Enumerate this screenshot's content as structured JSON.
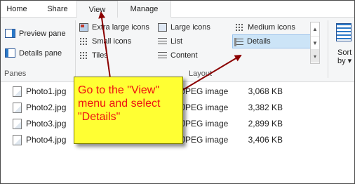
{
  "tabs": [
    "Home",
    "Share",
    "View",
    "Manage"
  ],
  "panes": {
    "preview_label": "Preview pane",
    "details_label": "Details pane",
    "group_label": "Panes"
  },
  "layout": {
    "group_label": "Layout",
    "items": {
      "extra_large": "Extra large icons",
      "large": "Large icons",
      "medium": "Medium icons",
      "small": "Small icons",
      "list": "List",
      "details": "Details",
      "tiles": "Tiles",
      "content": "Content"
    },
    "selected": "Details"
  },
  "sort": {
    "line1": "Sort",
    "line2": "by ▾"
  },
  "files": [
    {
      "name": "Photo1.jpg",
      "type": "JPEG image",
      "size": "3,068 KB"
    },
    {
      "name": "Photo2.jpg",
      "type": "JPEG image",
      "size": "3,382 KB"
    },
    {
      "name": "Photo3.jpg",
      "type": "JPEG image",
      "size": "2,899 KB"
    },
    {
      "name": "Photo4.jpg",
      "type": "JPEG image",
      "size": "3,406 KB"
    }
  ],
  "callout": {
    "text": "Go to the \"View\" menu and select \"Details\"",
    "fill_color": "#ffff33",
    "text_color": "#ee1111",
    "arrow_color": "#8b0000"
  },
  "colors": {
    "ribbon_bg": "#f5f6f7",
    "selected_bg": "#cce4f7",
    "selected_border": "#99c2ec"
  }
}
